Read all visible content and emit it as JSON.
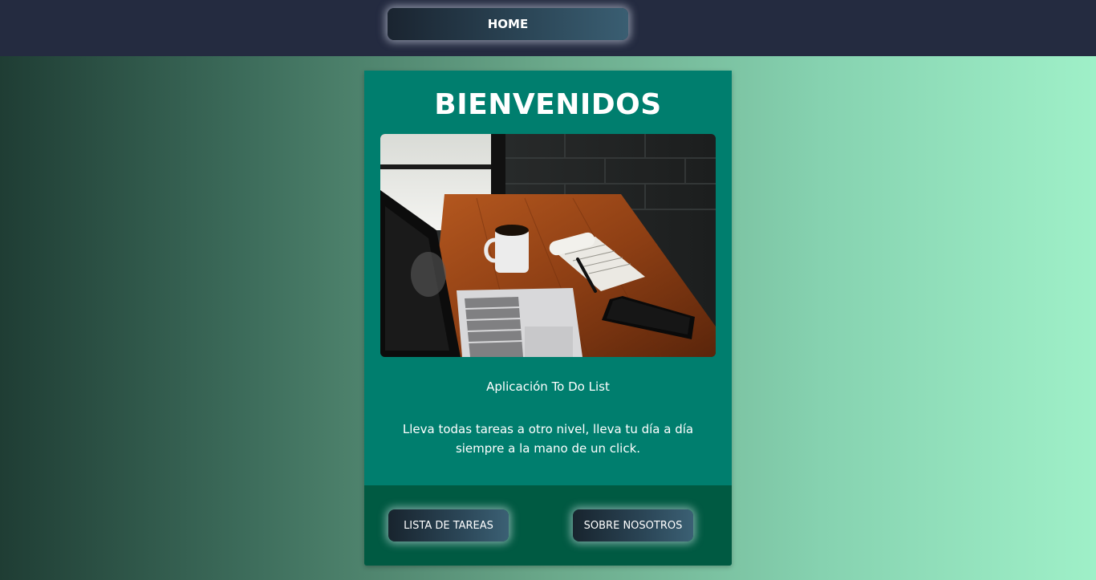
{
  "nav": {
    "home_label": "HOME"
  },
  "card": {
    "title": "BIENVENIDOS",
    "image_subject": "laptop-coffee-notepad-phone-on-wooden-desk",
    "subtitle": "Aplicación To Do List",
    "description": "Lleva todas tareas a otro nivel, lleva tu día a día siempre a la mano de un click."
  },
  "footer": {
    "buttons": [
      {
        "label": "LISTA DE TAREAS"
      },
      {
        "label": "SOBRE NOSOTROS"
      }
    ]
  },
  "colors": {
    "topbar": "#242b40",
    "card": "#007e6e",
    "card_footer": "#005a42",
    "background_left": "#1f3d34",
    "background_right": "#9ff0c8"
  }
}
